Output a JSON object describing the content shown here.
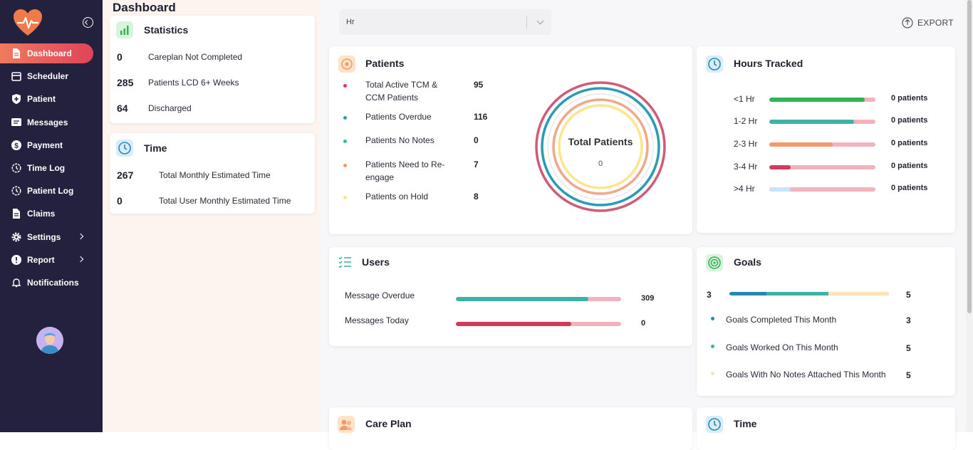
{
  "sidebar": {
    "items": [
      {
        "label": "Dashboard",
        "icon": "document-icon"
      },
      {
        "label": "Scheduler",
        "icon": "calendar-icon"
      },
      {
        "label": "Patient",
        "icon": "shield-icon"
      },
      {
        "label": "Messages",
        "icon": "message-icon"
      },
      {
        "label": "Payment",
        "icon": "dollar-icon"
      },
      {
        "label": "Time Log",
        "icon": "history-icon"
      },
      {
        "label": "Patient Log",
        "icon": "history-icon"
      },
      {
        "label": "Claims",
        "icon": "document-icon"
      },
      {
        "label": "Settings",
        "icon": "gear-icon"
      },
      {
        "label": "Report",
        "icon": "alert-icon"
      },
      {
        "label": "Notifications",
        "icon": "bell-icon"
      }
    ]
  },
  "page": {
    "title": "Dashboard"
  },
  "statistics": {
    "title": "Statistics",
    "rows": [
      {
        "value": "0",
        "label": "Careplan Not Completed"
      },
      {
        "value": "285",
        "label": "Patients LCD 6+ Weeks"
      },
      {
        "value": "64",
        "label": "Discharged"
      }
    ]
  },
  "time_card": {
    "title": "Time",
    "rows": [
      {
        "value": "267",
        "label": "Total Monthly Estimated Time"
      },
      {
        "value": "0",
        "label": "Total User Monthly Estimated Time"
      }
    ]
  },
  "filter": {
    "value": "Hr"
  },
  "export": {
    "label": "EXPORT"
  },
  "patients": {
    "title": "Patients",
    "rows": [
      {
        "label": "Total Active TCM & CCM Patients",
        "value": "95",
        "color": "#d23a5a"
      },
      {
        "label": "Patients Overdue",
        "value": "116",
        "color": "#2a9bb5"
      },
      {
        "label": "Patients No Notes",
        "value": "0",
        "color": "#3bb3a5"
      },
      {
        "label": "Patients Need to Re-engage",
        "value": "7",
        "color": "#f39a6b"
      },
      {
        "label": "Patients on Hold",
        "value": "8",
        "color": "#fbe58f"
      }
    ],
    "donut_title": "Total Patients",
    "donut_value": "0"
  },
  "hours": {
    "title": "Hours Tracked",
    "rows": [
      {
        "label": "<1 Hr",
        "value": "0 patients",
        "fill": 0.9,
        "color": "#2fb457"
      },
      {
        "label": "1-2 Hr",
        "value": "0 patients",
        "fill": 0.8,
        "color": "#3bb3a5"
      },
      {
        "label": "2-3 Hr",
        "value": "0 patients",
        "fill": 0.6,
        "color": "#f39a6b"
      },
      {
        "label": "3-4 Hr",
        "value": "0 patients",
        "fill": 0.2,
        "color": "#d23a5a"
      },
      {
        "label": ">4 Hr",
        "value": "0 patients",
        "fill": 0.2,
        "color": "#c8e4f8"
      }
    ]
  },
  "users": {
    "title": "Users",
    "rows": [
      {
        "label": "Message Overdue",
        "value": "309",
        "fill": 0.8,
        "color": "#3bb3a5"
      },
      {
        "label": "Messages Today",
        "value": "0",
        "fill": 0.7,
        "color": "#d23a5a"
      }
    ]
  },
  "goals": {
    "title": "Goals",
    "left": "3",
    "right": "5",
    "rows": [
      {
        "label": "Goals Completed This Month",
        "value": "3",
        "color": "#2a86b5"
      },
      {
        "label": "Goals Worked On This Month",
        "value": "5",
        "color": "#3bb3a5"
      },
      {
        "label": "Goals With No Notes Attached This Month",
        "value": "5",
        "color": "#fbe3b8"
      }
    ]
  },
  "care_plan": {
    "title": "Care Plan"
  },
  "time2": {
    "title": "Time"
  }
}
